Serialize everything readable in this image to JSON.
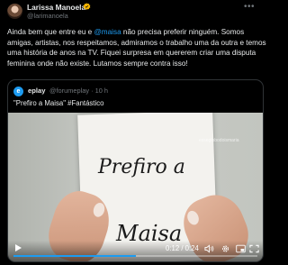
{
  "author": {
    "name": "Larissa Manoela",
    "handle": "@larimanoela",
    "more_icon": "more-icon",
    "verified_icon": "verified-badge-icon"
  },
  "tweet": {
    "part1": "Ainda bem que entre eu e ",
    "mention": "@maisa",
    "part2": " não precisa preferir ninguém. Somos amigas, artistas, nos respeitamos, admiramos o trabalho uma da outra e temos uma história de anos na TV. Fiquei surpresa em quererem criar uma disputa feminina onde não existe. Lutamos sempre contra isso!"
  },
  "quote": {
    "avatar_letter": "e",
    "name": "eplay",
    "handle_time": "@forumeplay · 10 h",
    "text": "\"Prefiro a Maisa\" #Fantástico"
  },
  "video": {
    "card_line1": "Prefiro a",
    "card_line2": "Maisa",
    "watermark": "esseglobodoismaria",
    "time": "0:12 / 0:24",
    "progress": 0.5
  },
  "colors": {
    "accent": "#1d9bf0",
    "background": "#000000",
    "muted": "#71767b"
  }
}
